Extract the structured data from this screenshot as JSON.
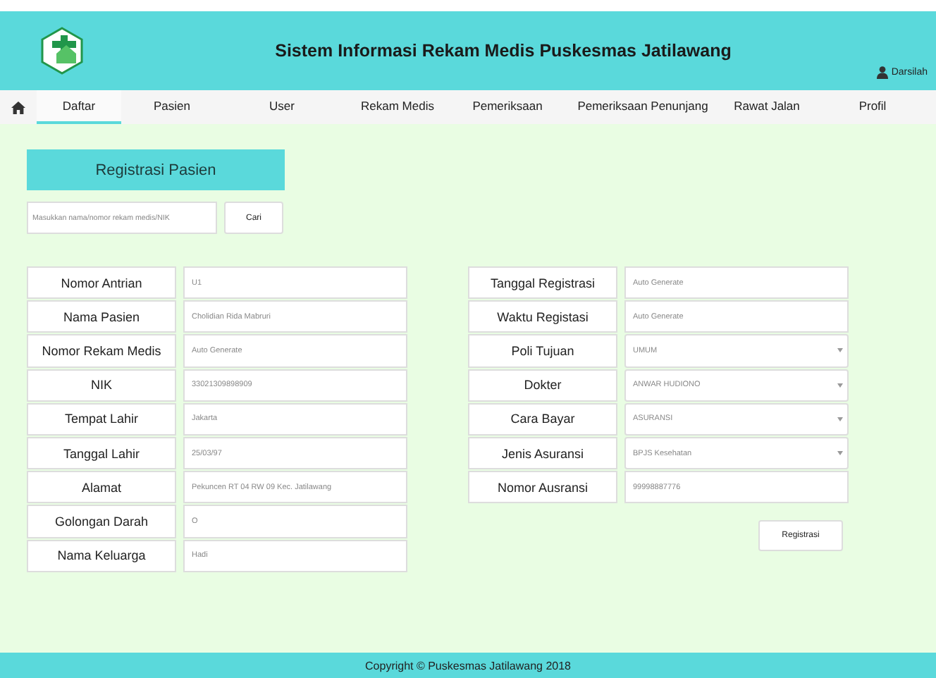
{
  "header": {
    "title": "Sistem Informasi Rekam Medis Puskesmas Jatilawang",
    "user": "Darsilah"
  },
  "nav": [
    {
      "label": "Daftar",
      "selected": true
    },
    {
      "label": "Pasien",
      "selected": false
    },
    {
      "label": "User",
      "selected": false
    },
    {
      "label": "Rekam Medis",
      "selected": false
    },
    {
      "label": "Pemeriksaan",
      "selected": false
    },
    {
      "label": "Pemeriksaan Penunjang",
      "selected": false
    },
    {
      "label": "Rawat Jalan",
      "selected": false
    },
    {
      "label": "Profil",
      "selected": false
    }
  ],
  "section_title": "Registrasi Pasien",
  "search": {
    "placeholder": "Masukkan nama/nomor rekam medis/NIK",
    "button": "Cari"
  },
  "patient_form": [
    {
      "label": "Nomor Antrian",
      "value": "U1",
      "kind": "text"
    },
    {
      "label": "Nama Pasien",
      "value": "Cholidian Rida Mabruri",
      "kind": "text"
    },
    {
      "label": "Nomor Rekam Medis",
      "value": "Auto Generate",
      "kind": "text"
    },
    {
      "label": "NIK",
      "value": "33021309898909",
      "kind": "text"
    },
    {
      "label": "Tempat Lahir",
      "value": "Jakarta",
      "kind": "text"
    },
    {
      "label": "Tanggal Lahir",
      "value": "25/03/97",
      "kind": "text"
    },
    {
      "label": "Alamat",
      "value": "Pekuncen RT 04 RW 09 Kec. Jatilawang",
      "kind": "text"
    },
    {
      "label": "Golongan Darah",
      "value": "O",
      "kind": "text"
    },
    {
      "label": "Nama Keluarga",
      "value": "Hadi",
      "kind": "text"
    }
  ],
  "visit_form": [
    {
      "label": "Tanggal Registrasi",
      "value": "Auto Generate",
      "kind": "text"
    },
    {
      "label": "Waktu Registasi",
      "value": "Auto Generate",
      "kind": "text"
    },
    {
      "label": "Poli Tujuan",
      "value": "UMUM",
      "kind": "select"
    },
    {
      "label": "Dokter",
      "value": "ANWAR HUDIONO",
      "kind": "select"
    },
    {
      "label": "Cara Bayar",
      "value": "ASURANSI",
      "kind": "select"
    },
    {
      "label": "Jenis Asuransi",
      "value": "BPJS Kesehatan",
      "kind": "select"
    },
    {
      "label": "Nomor Ausransi",
      "value": "99998887776",
      "kind": "text"
    }
  ],
  "submit_button": "Registrasi",
  "footer": "Copyright © Puskesmas Jatilawang 2018"
}
